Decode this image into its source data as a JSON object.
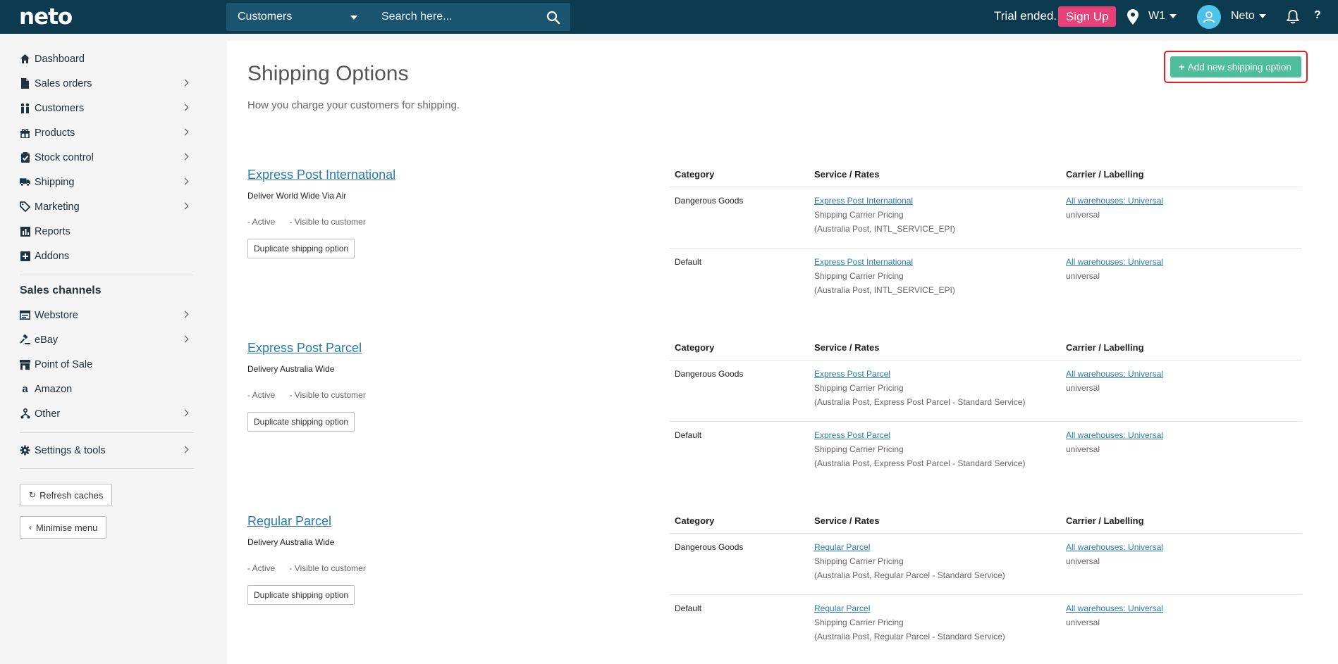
{
  "brand": {
    "logo": "neto"
  },
  "topbar": {
    "search_category": "Customers",
    "search_placeholder": "Search here...",
    "trial_text": "Trial ended.",
    "signup_label": "Sign Up",
    "warehouse": "W1",
    "user": "Neto",
    "help": "?"
  },
  "sidebar": {
    "items": [
      {
        "label": "Dashboard",
        "icon": "home-icon"
      },
      {
        "label": "Sales orders",
        "icon": "document-icon"
      },
      {
        "label": "Customers",
        "icon": "users-icon"
      },
      {
        "label": "Products",
        "icon": "gift-icon"
      },
      {
        "label": "Stock control",
        "icon": "clipboard-check-icon"
      },
      {
        "label": "Shipping",
        "icon": "truck-icon"
      },
      {
        "label": "Marketing",
        "icon": "tag-icon"
      },
      {
        "label": "Reports",
        "icon": "bar-chart-icon"
      },
      {
        "label": "Addons",
        "icon": "plus-square-icon"
      }
    ],
    "sales_channels_title": "Sales channels",
    "channels": [
      {
        "label": "Webstore",
        "icon": "browser-icon"
      },
      {
        "label": "eBay",
        "icon": "gavel-icon"
      },
      {
        "label": "Point of Sale",
        "icon": "store-icon"
      },
      {
        "label": "Amazon",
        "icon": "amazon-icon"
      },
      {
        "label": "Other",
        "icon": "share-nodes-icon"
      }
    ],
    "settings_label": "Settings & tools",
    "refresh_label": "Refresh caches",
    "minimise_label": "Minimise menu"
  },
  "page": {
    "title": "Shipping Options",
    "subtitle": "How you charge your customers for shipping.",
    "add_button": "Add new shipping option",
    "col_category": "Category",
    "col_service": "Service / Rates",
    "col_carrier": "Carrier / Labelling",
    "duplicate_label": "Duplicate shipping option"
  },
  "options": [
    {
      "name": "Express Post International",
      "description": "Deliver World Wide Via Air",
      "status_active": "- Active",
      "status_visible": "- Visible to customer",
      "rows": [
        {
          "category": "Dangerous Goods",
          "service": "Express Post International",
          "pricing": "Shipping Carrier Pricing",
          "detail": "(Australia Post, INTL_SERVICE_EPI)",
          "carrier": "All warehouses: Universal",
          "label": "universal"
        },
        {
          "category": "Default",
          "service": "Express Post International",
          "pricing": "Shipping Carrier Pricing",
          "detail": "(Australia Post, INTL_SERVICE_EPI)",
          "carrier": "All warehouses: Universal",
          "label": "universal"
        }
      ]
    },
    {
      "name": "Express Post Parcel",
      "description": "Delivery Australia Wide",
      "status_active": "- Active",
      "status_visible": "- Visible to customer",
      "rows": [
        {
          "category": "Dangerous Goods",
          "service": "Express Post Parcel",
          "pricing": "Shipping Carrier Pricing",
          "detail": "(Australia Post, Express Post Parcel - Standard Service)",
          "carrier": "All warehouses: Universal",
          "label": "universal"
        },
        {
          "category": "Default",
          "service": "Express Post Parcel",
          "pricing": "Shipping Carrier Pricing",
          "detail": "(Australia Post, Express Post Parcel - Standard Service)",
          "carrier": "All warehouses: Universal",
          "label": "universal"
        }
      ]
    },
    {
      "name": "Regular Parcel",
      "description": "Delivery Australia Wide",
      "status_active": "- Active",
      "status_visible": "- Visible to customer",
      "rows": [
        {
          "category": "Dangerous Goods",
          "service": "Regular Parcel",
          "pricing": "Shipping Carrier Pricing",
          "detail": "(Australia Post, Regular Parcel - Standard Service)",
          "carrier": "All warehouses: Universal",
          "label": "universal"
        },
        {
          "category": "Default",
          "service": "Regular Parcel",
          "pricing": "Shipping Carrier Pricing",
          "detail": "(Australia Post, Regular Parcel - Standard Service)",
          "carrier": "All warehouses: Universal",
          "label": "universal"
        }
      ]
    }
  ]
}
